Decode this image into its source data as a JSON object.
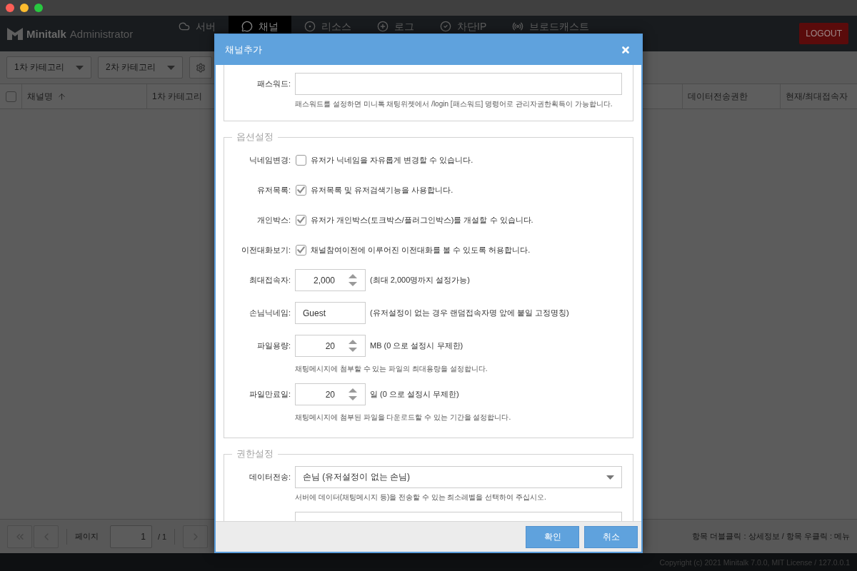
{
  "header": {
    "logo_name": "Minitalk",
    "logo_suffix": "Administrator",
    "nav": [
      {
        "label": "서버",
        "selected": false
      },
      {
        "label": "채널",
        "selected": true
      },
      {
        "label": "리소스",
        "selected": false
      },
      {
        "label": "로그",
        "selected": false
      },
      {
        "label": "차단IP",
        "selected": false
      },
      {
        "label": "브로드캐스트",
        "selected": false
      }
    ],
    "logout": "LOGOUT"
  },
  "toolbar": {
    "selects": [
      "1차 카테고리",
      "2차 카테고리"
    ]
  },
  "table": {
    "select_all": {
      "checked": false
    },
    "columns": [
      {
        "label": "채널명",
        "sorted": true
      },
      {
        "label": "1차 카테고리",
        "sorted": false
      },
      {
        "label": "데이터전송권한",
        "sorted": false
      },
      {
        "label": "현재/최대접속자",
        "sorted": false
      }
    ]
  },
  "pagination": {
    "page_label": "페이지",
    "page": "1",
    "total": "/ 1",
    "hint": "항목 더블클릭 : 상세정보 / 항목 우클릭 : 메뉴"
  },
  "footer": {
    "copyright": "Copyright (c) 2021 Minitalk 7.0.0, MIT License / 127.0.0.1"
  },
  "dialog": {
    "title": "채널추가",
    "sections": [
      {
        "rows": [
          {
            "kind": "password",
            "label": "패스워드:",
            "help": "패스워드를 설정하면 미니톡 채팅위젯에서 /login [패스워드] 명령어로 관리자권한획득이 가능합니다."
          }
        ]
      },
      {
        "legend": "옵션설정",
        "rows": [
          {
            "kind": "checkbox",
            "label": "닉네임변경:",
            "checked": false,
            "text": "유저가 닉네임을 자유롭게 변경할 수 있습니다."
          },
          {
            "kind": "checkbox",
            "label": "유저목록:",
            "checked": true,
            "text": "유저목록 및 유저검색기능을 사용합니다."
          },
          {
            "kind": "checkbox",
            "label": "개인박스:",
            "checked": true,
            "text": "유저가 개인박스(토크박스/플러그인박스)를 개설할 수 있습니다."
          },
          {
            "kind": "checkbox",
            "label": "이전대화보기:",
            "checked": true,
            "text": "채널참여이전에 이루어진 이전대화를 볼 수 있도록 허용합니다."
          },
          {
            "kind": "number",
            "label": "최대접속자:",
            "value": "2,000",
            "note": "(최대 2,000명까지 설정가능)"
          },
          {
            "kind": "text",
            "label": "손님닉네임:",
            "value": "Guest",
            "note": "(유저설정이 없는 경우 랜덤접속자명 앞에 붙일 고정명칭)"
          },
          {
            "kind": "number",
            "label": "파일용량:",
            "value": "20",
            "note": "MB (0 으로 설정시 무제한)",
            "help": "채팅메시지에 첨부할 수 있는 파일의 최대용량을 설정합니다."
          },
          {
            "kind": "number",
            "label": "파일만료일:",
            "value": "20",
            "note": "일 (0 으로 설정시 무제한)",
            "help": "채팅메시지에 첨부된 파일을 다운로드할 수 있는 기간을 설정합니다."
          }
        ]
      },
      {
        "legend": "권한설정",
        "rows": [
          {
            "kind": "select",
            "label": "데이터전송:",
            "value": "손님 (유저설정이 없는 손님)",
            "help": "서버에 데이터(채팅메시지 등)을 전송할 수 있는 최소레벨을 선택하여 주십시오."
          },
          {
            "kind": "select"
          }
        ]
      }
    ],
    "buttons": [
      "확인",
      "취소"
    ]
  }
}
